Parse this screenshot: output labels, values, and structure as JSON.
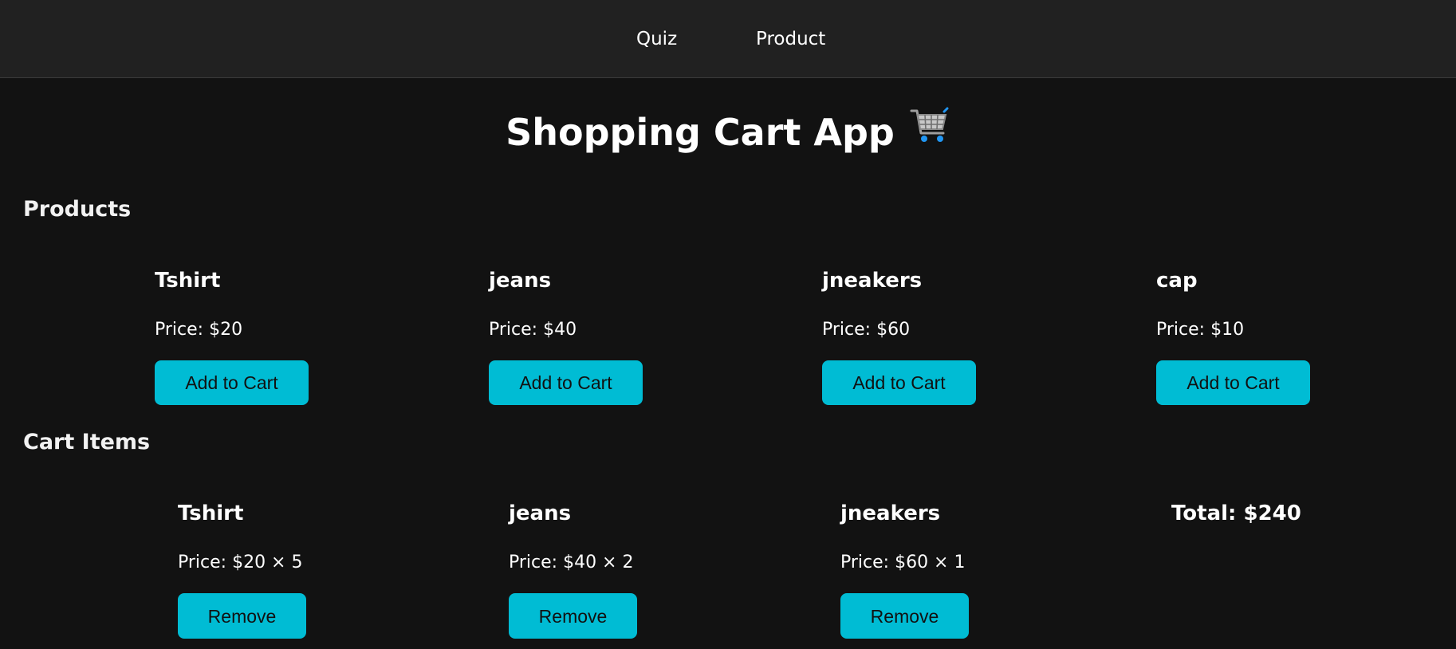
{
  "nav": {
    "items": [
      {
        "label": "Quiz"
      },
      {
        "label": "Product"
      }
    ]
  },
  "header": {
    "title": "Shopping Cart App",
    "title_icon": "shopping-cart-icon"
  },
  "products": {
    "heading": "Products",
    "items": [
      {
        "name": "Tshirt",
        "price": "Price: $20",
        "button": "Add to Cart"
      },
      {
        "name": "jeans",
        "price": "Price: $40",
        "button": "Add to Cart"
      },
      {
        "name": "jneakers",
        "price": "Price: $60",
        "button": "Add to Cart"
      },
      {
        "name": "cap",
        "price": "Price: $10",
        "button": "Add to Cart"
      }
    ]
  },
  "cart": {
    "heading": "Cart Items",
    "items": [
      {
        "name": "Tshirt",
        "price": "Price: $20 × 5",
        "button": "Remove"
      },
      {
        "name": "jeans",
        "price": "Price: $40 × 2",
        "button": "Remove"
      },
      {
        "name": "jneakers",
        "price": "Price: $60 × 1",
        "button": "Remove"
      }
    ],
    "total": "Total: $240"
  },
  "colors": {
    "background": "#121212",
    "navbar": "#212121",
    "accent": "#00bcd4",
    "text": "#ffffff"
  }
}
